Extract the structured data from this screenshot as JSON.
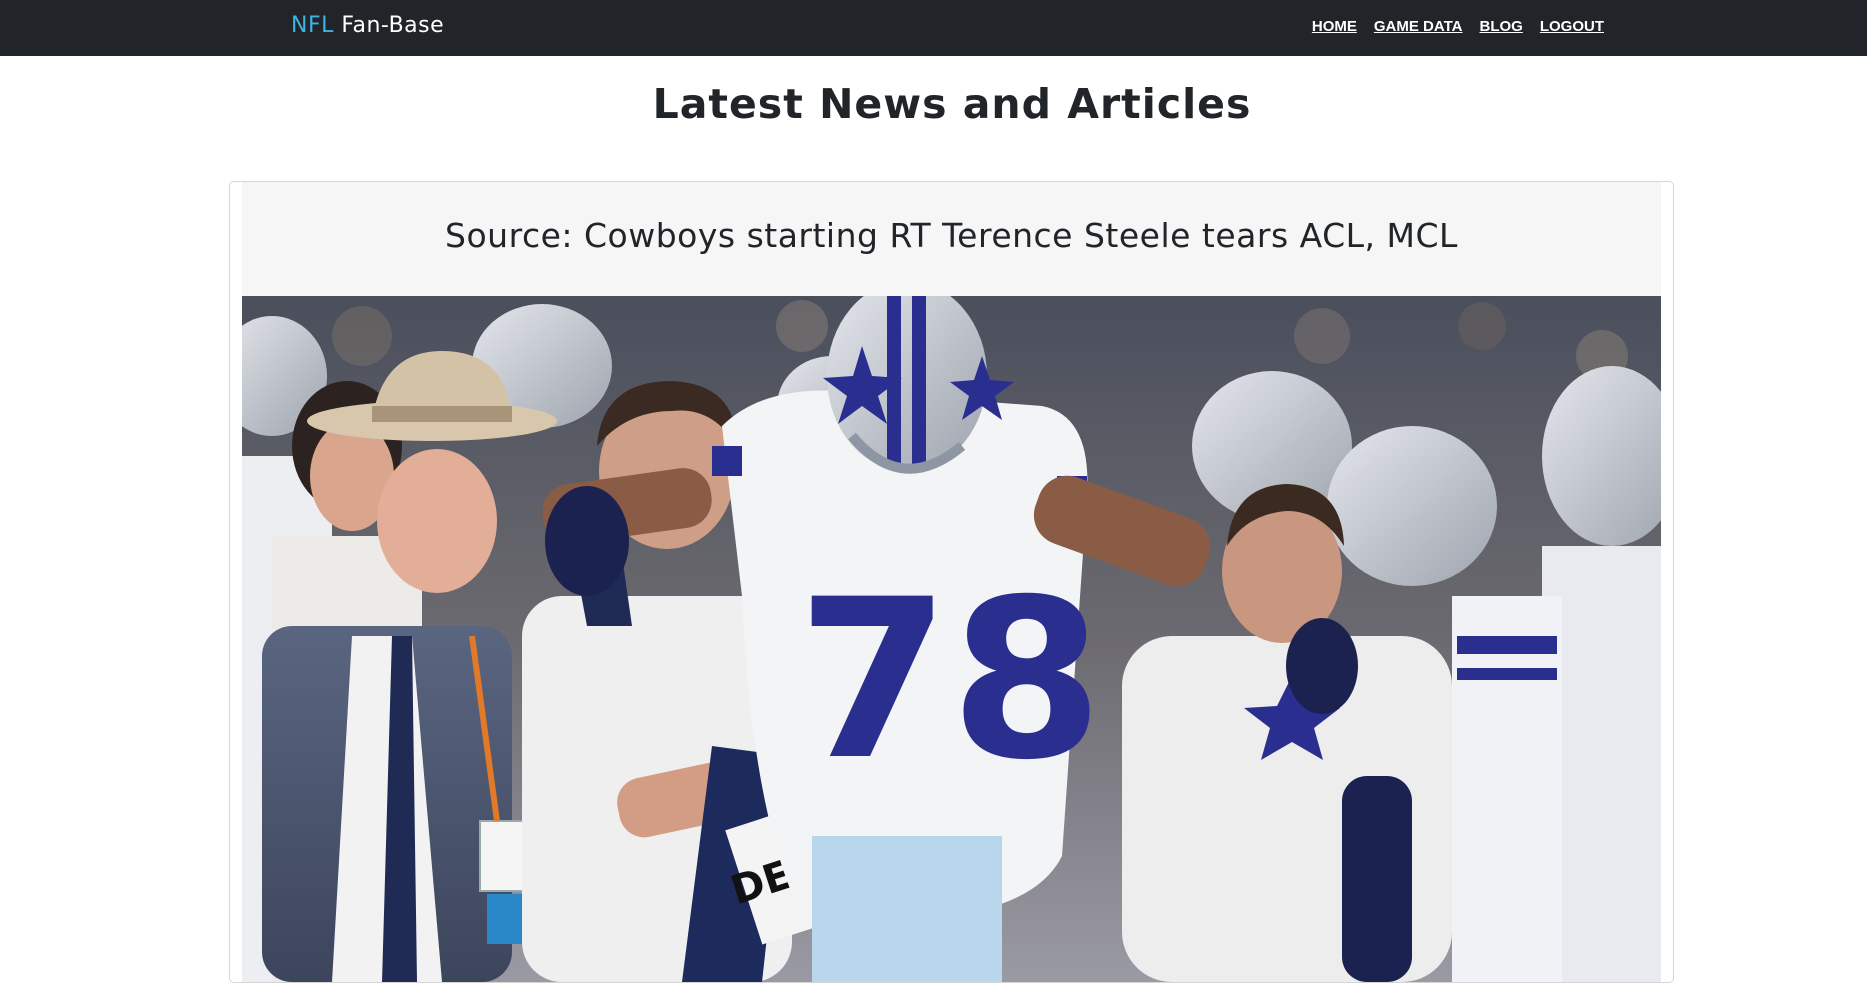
{
  "nav": {
    "brand_accent": "NFL",
    "brand_rest": "Fan-Base",
    "links": [
      {
        "label": "HOME"
      },
      {
        "label": "GAME DATA"
      },
      {
        "label": "BLOG"
      },
      {
        "label": "LOGOUT"
      }
    ]
  },
  "page": {
    "title": "Latest News and Articles"
  },
  "articles": [
    {
      "title": "Source: Cowboys starting RT Terence Steele tears ACL, MCL",
      "image_jersey_number": "78",
      "image_towel_text": "DE"
    }
  ],
  "colors": {
    "navbar_bg": "#212529",
    "brand_accent": "#3fb3e0",
    "card_header_bg": "#f6f6f6",
    "jersey_blue": "#2a2f8f"
  }
}
